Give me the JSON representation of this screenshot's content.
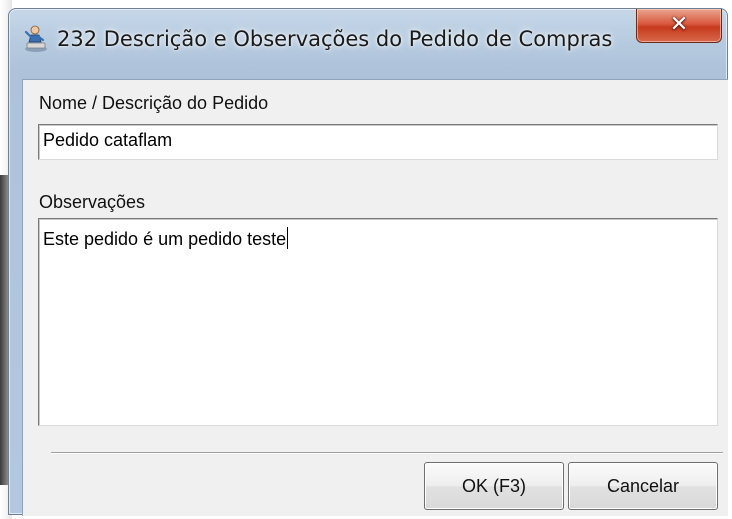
{
  "window": {
    "title": "232 Descrição e Observações do Pedido de Compras",
    "close_symbol": "✕",
    "icon": "app-user-icon"
  },
  "form": {
    "name_label": "Nome / Descrição do Pedido",
    "name_value": "Pedido cataflam",
    "notes_label": "Observações",
    "notes_value": "Este pedido é um pedido teste"
  },
  "buttons": {
    "ok_label": "OK (F3)",
    "cancel_label": "Cancelar"
  },
  "colors": {
    "titlebar": "#b6cadf",
    "close_button": "#d9583e",
    "client_background": "#f0f0f0"
  }
}
